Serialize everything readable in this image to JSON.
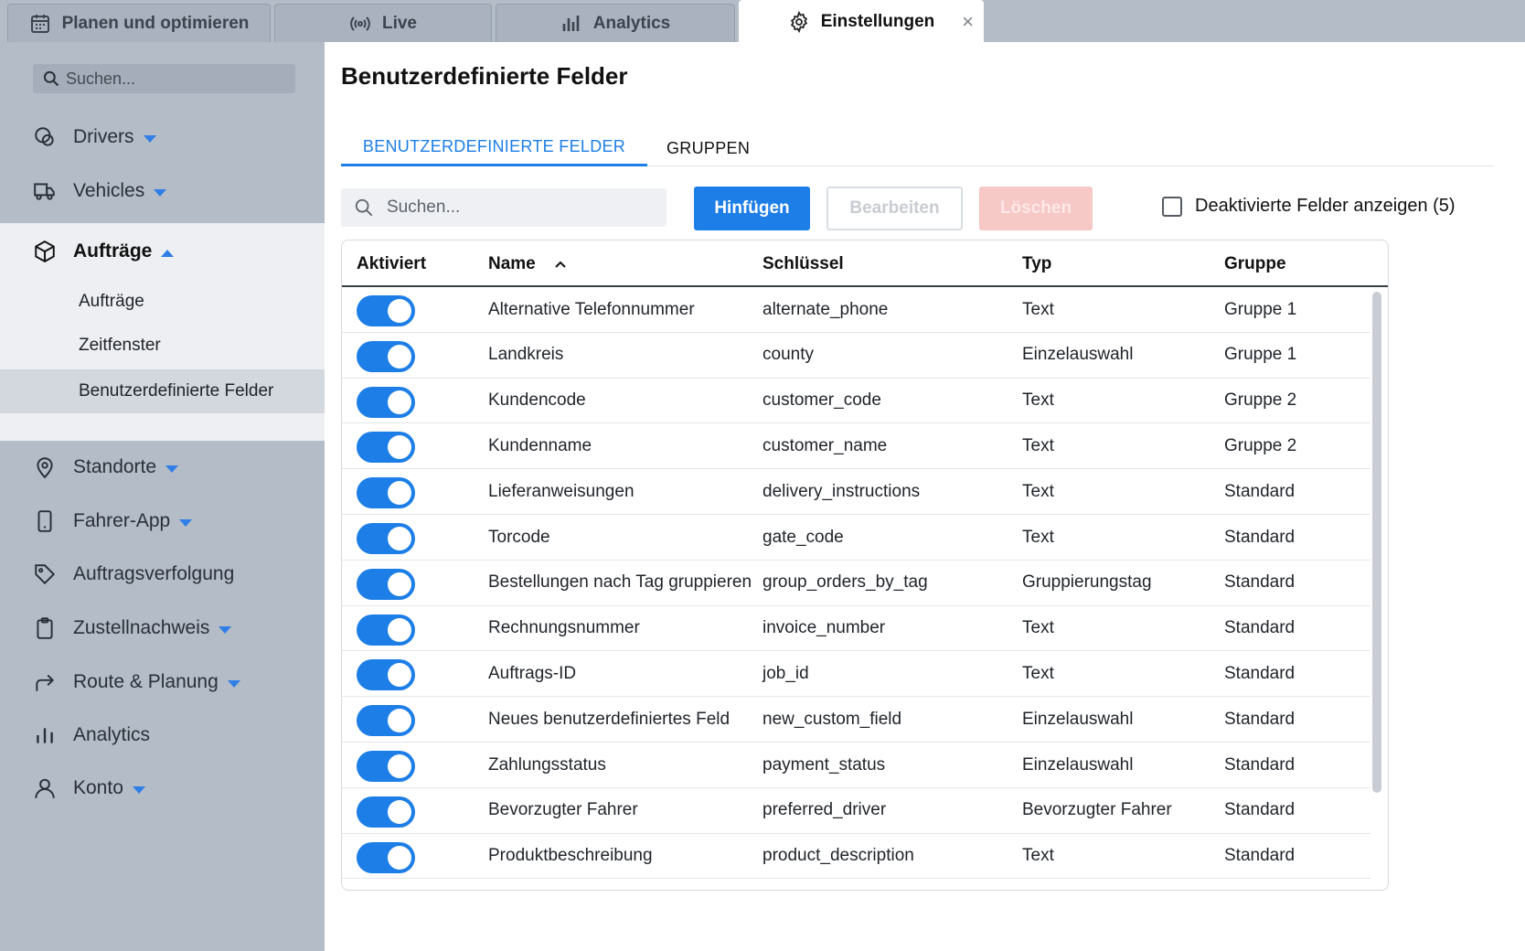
{
  "app_tabs": [
    {
      "label": "Planen und optimieren",
      "icon": "calendar-icon"
    },
    {
      "label": "Live",
      "icon": "live-signal-icon"
    },
    {
      "label": "Analytics",
      "icon": "bar-chart-icon"
    },
    {
      "label": "Einstellungen",
      "icon": "gear-icon",
      "active": true,
      "close": "×"
    }
  ],
  "sidebar": {
    "search_placeholder": "Suchen...",
    "items": [
      {
        "label": "Drivers",
        "icon": "drivers-icon",
        "expandable": true
      },
      {
        "label": "Vehicles",
        "icon": "truck-icon",
        "expandable": true
      },
      {
        "label": "Aufträge",
        "icon": "box-icon",
        "expanded": true,
        "children": [
          "Aufträge",
          "Zeitfenster",
          "Benutzerdefinierte Felder"
        ],
        "selected_child": "Benutzerdefinierte Felder"
      },
      {
        "label": "Standorte",
        "icon": "location-pin-icon",
        "expandable": true
      },
      {
        "label": "Fahrer-App",
        "icon": "phone-icon",
        "expandable": true
      },
      {
        "label": "Auftragsverfolgung",
        "icon": "tag-icon",
        "expandable": false
      },
      {
        "label": "Zustellnachweis",
        "icon": "clipboard-icon",
        "expandable": true
      },
      {
        "label": "Route & Planung",
        "icon": "route-arrow-icon",
        "expandable": true
      },
      {
        "label": "Analytics",
        "icon": "bar-chart-icon",
        "expandable": false
      },
      {
        "label": "Konto",
        "icon": "user-icon",
        "expandable": true
      }
    ]
  },
  "main": {
    "title": "Benutzerdefinierte Felder",
    "tabs": [
      {
        "label": "BENUTZERDEFINIERTE FELDER",
        "active": true
      },
      {
        "label": "GRUPPEN",
        "active": false
      }
    ],
    "search_placeholder": "Suchen...",
    "buttons": {
      "add": "Hinfügen",
      "edit": "Bearbeiten",
      "delete": "Löschen"
    },
    "show_disabled_label": "Deaktivierte Felder anzeigen (5)",
    "show_disabled_checked": false,
    "columns": [
      "Aktiviert",
      "Name",
      "Schlüssel",
      "Typ",
      "Gruppe"
    ],
    "sort": {
      "column": "Name",
      "direction": "ascending"
    },
    "rows": [
      {
        "enabled": true,
        "name": "Alternative Telefonnummer",
        "key": "alternate_phone",
        "type": "Text",
        "group": "Gruppe 1"
      },
      {
        "enabled": true,
        "name": "Landkreis",
        "key": "county",
        "type": "Einzelauswahl",
        "group": "Gruppe 1"
      },
      {
        "enabled": true,
        "name": "Kundencode",
        "key": "customer_code",
        "type": "Text",
        "group": "Gruppe 2"
      },
      {
        "enabled": true,
        "name": "Kundenname",
        "key": "customer_name",
        "type": "Text",
        "group": "Gruppe 2"
      },
      {
        "enabled": true,
        "name": "Lieferanweisungen",
        "key": "delivery_instructions",
        "type": "Text",
        "group": "Standard"
      },
      {
        "enabled": true,
        "name": "Torcode",
        "key": "gate_code",
        "type": "Text",
        "group": "Standard"
      },
      {
        "enabled": true,
        "name": "Bestellungen nach Tag gruppieren",
        "key": "group_orders_by_tag",
        "type": "Gruppierungstag",
        "group": "Standard"
      },
      {
        "enabled": true,
        "name": "Rechnungsnummer",
        "key": "invoice_number",
        "type": "Text",
        "group": "Standard"
      },
      {
        "enabled": true,
        "name": "Auftrags-ID",
        "key": "job_id",
        "type": "Text",
        "group": "Standard"
      },
      {
        "enabled": true,
        "name": "Neues benutzerdefiniertes Feld",
        "key": "new_custom_field",
        "type": "Einzelauswahl",
        "group": "Standard"
      },
      {
        "enabled": true,
        "name": "Zahlungsstatus",
        "key": "payment_status",
        "type": "Einzelauswahl",
        "group": "Standard"
      },
      {
        "enabled": true,
        "name": "Bevorzugter Fahrer",
        "key": "preferred_driver",
        "type": "Bevorzugter Fahrer",
        "group": "Standard"
      },
      {
        "enabled": true,
        "name": "Produktbeschreibung",
        "key": "product_description",
        "type": "Text",
        "group": "Standard"
      }
    ]
  },
  "colors": {
    "accent": "#1c7ee6",
    "delete_disabled": "#f6c8c6",
    "sidebar_bg": "#b4bcc7"
  }
}
